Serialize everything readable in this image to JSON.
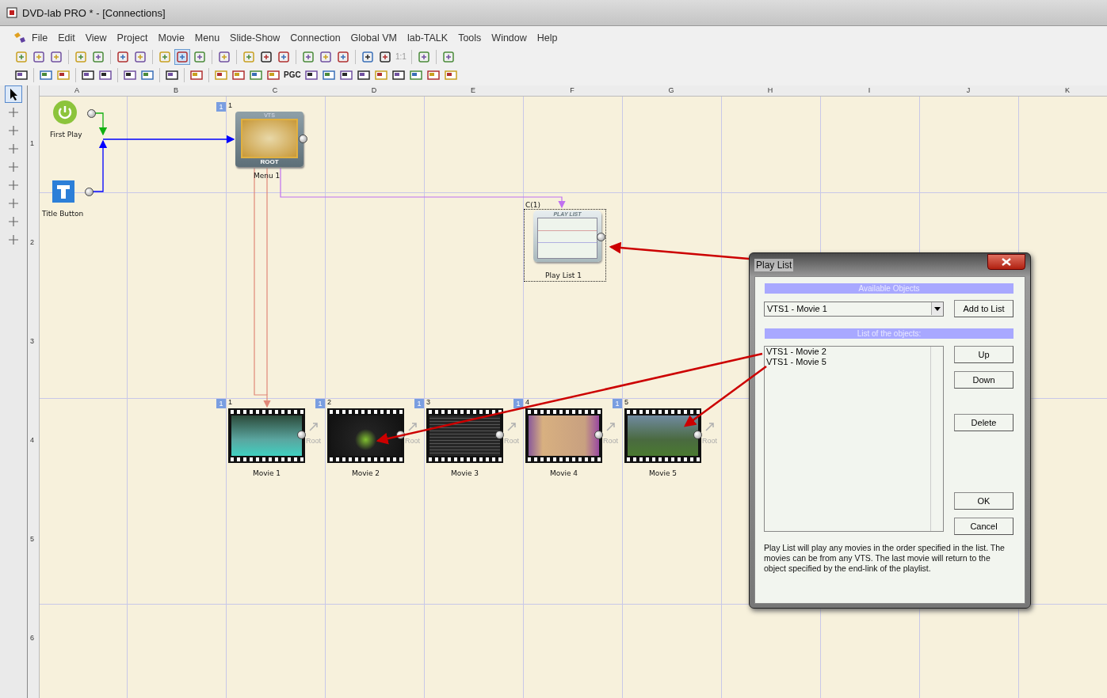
{
  "window": {
    "title": "DVD-lab PRO * - [Connections]"
  },
  "menu": [
    "File",
    "Edit",
    "View",
    "Project",
    "Movie",
    "Menu",
    "Slide-Show",
    "Connection",
    "Global VM",
    "lab-TALK",
    "Tools",
    "Window",
    "Help"
  ],
  "toolbar": {
    "zoom_reset": "1:1",
    "pgc": "PGC"
  },
  "left_tools": [
    {
      "selected": true
    },
    {
      "selected": false
    },
    {
      "selected": false
    },
    {
      "selected": false
    },
    {
      "selected": false
    },
    {
      "selected": false
    },
    {
      "selected": false
    },
    {
      "selected": false
    },
    {
      "selected": false
    }
  ],
  "canvas": {
    "columns": [
      "A",
      "B",
      "C",
      "D",
      "E",
      "F",
      "G",
      "H",
      "I",
      "J",
      "K"
    ],
    "rows": [
      "1",
      "2",
      "3",
      "4",
      "5",
      "6"
    ],
    "first_play": {
      "label": "First Play"
    },
    "title_button": {
      "label": "Title Button"
    },
    "menu_node": {
      "badge": "1",
      "number": "1",
      "top": "VTS",
      "bottom": "ROOT",
      "label": "Menu 1"
    },
    "playlist": {
      "caption": "C(1)",
      "header": "PLAY LIST",
      "label": "Play List 1"
    },
    "movies": [
      {
        "badge": "1",
        "number": "1",
        "label": "Movie 1",
        "link": "Root"
      },
      {
        "badge": "1",
        "number": "2",
        "label": "Movie 2",
        "link": "Root"
      },
      {
        "badge": "1",
        "number": "3",
        "label": "Movie 3",
        "link": "Root"
      },
      {
        "badge": "1",
        "number": "4",
        "label": "Movie 4",
        "link": "Root"
      },
      {
        "badge": "1",
        "number": "5",
        "label": "Movie 5",
        "link": "Root"
      }
    ]
  },
  "dialog": {
    "title": "Play List",
    "available_heading": "Available Objects",
    "dropdown_value": "VTS1 - Movie 1",
    "add_button": "Add to List",
    "list_heading": "List of the objects:",
    "items": [
      "VTS1 - Movie 2",
      "VTS1 - Movie 5"
    ],
    "side_buttons": [
      "Up",
      "Down",
      "Delete",
      "OK",
      "Cancel"
    ],
    "description": "Play List will play any movies in the order specified in the list. The movies can be from any VTS. The last movie will return to the object specified by the end-link of the playlist."
  }
}
